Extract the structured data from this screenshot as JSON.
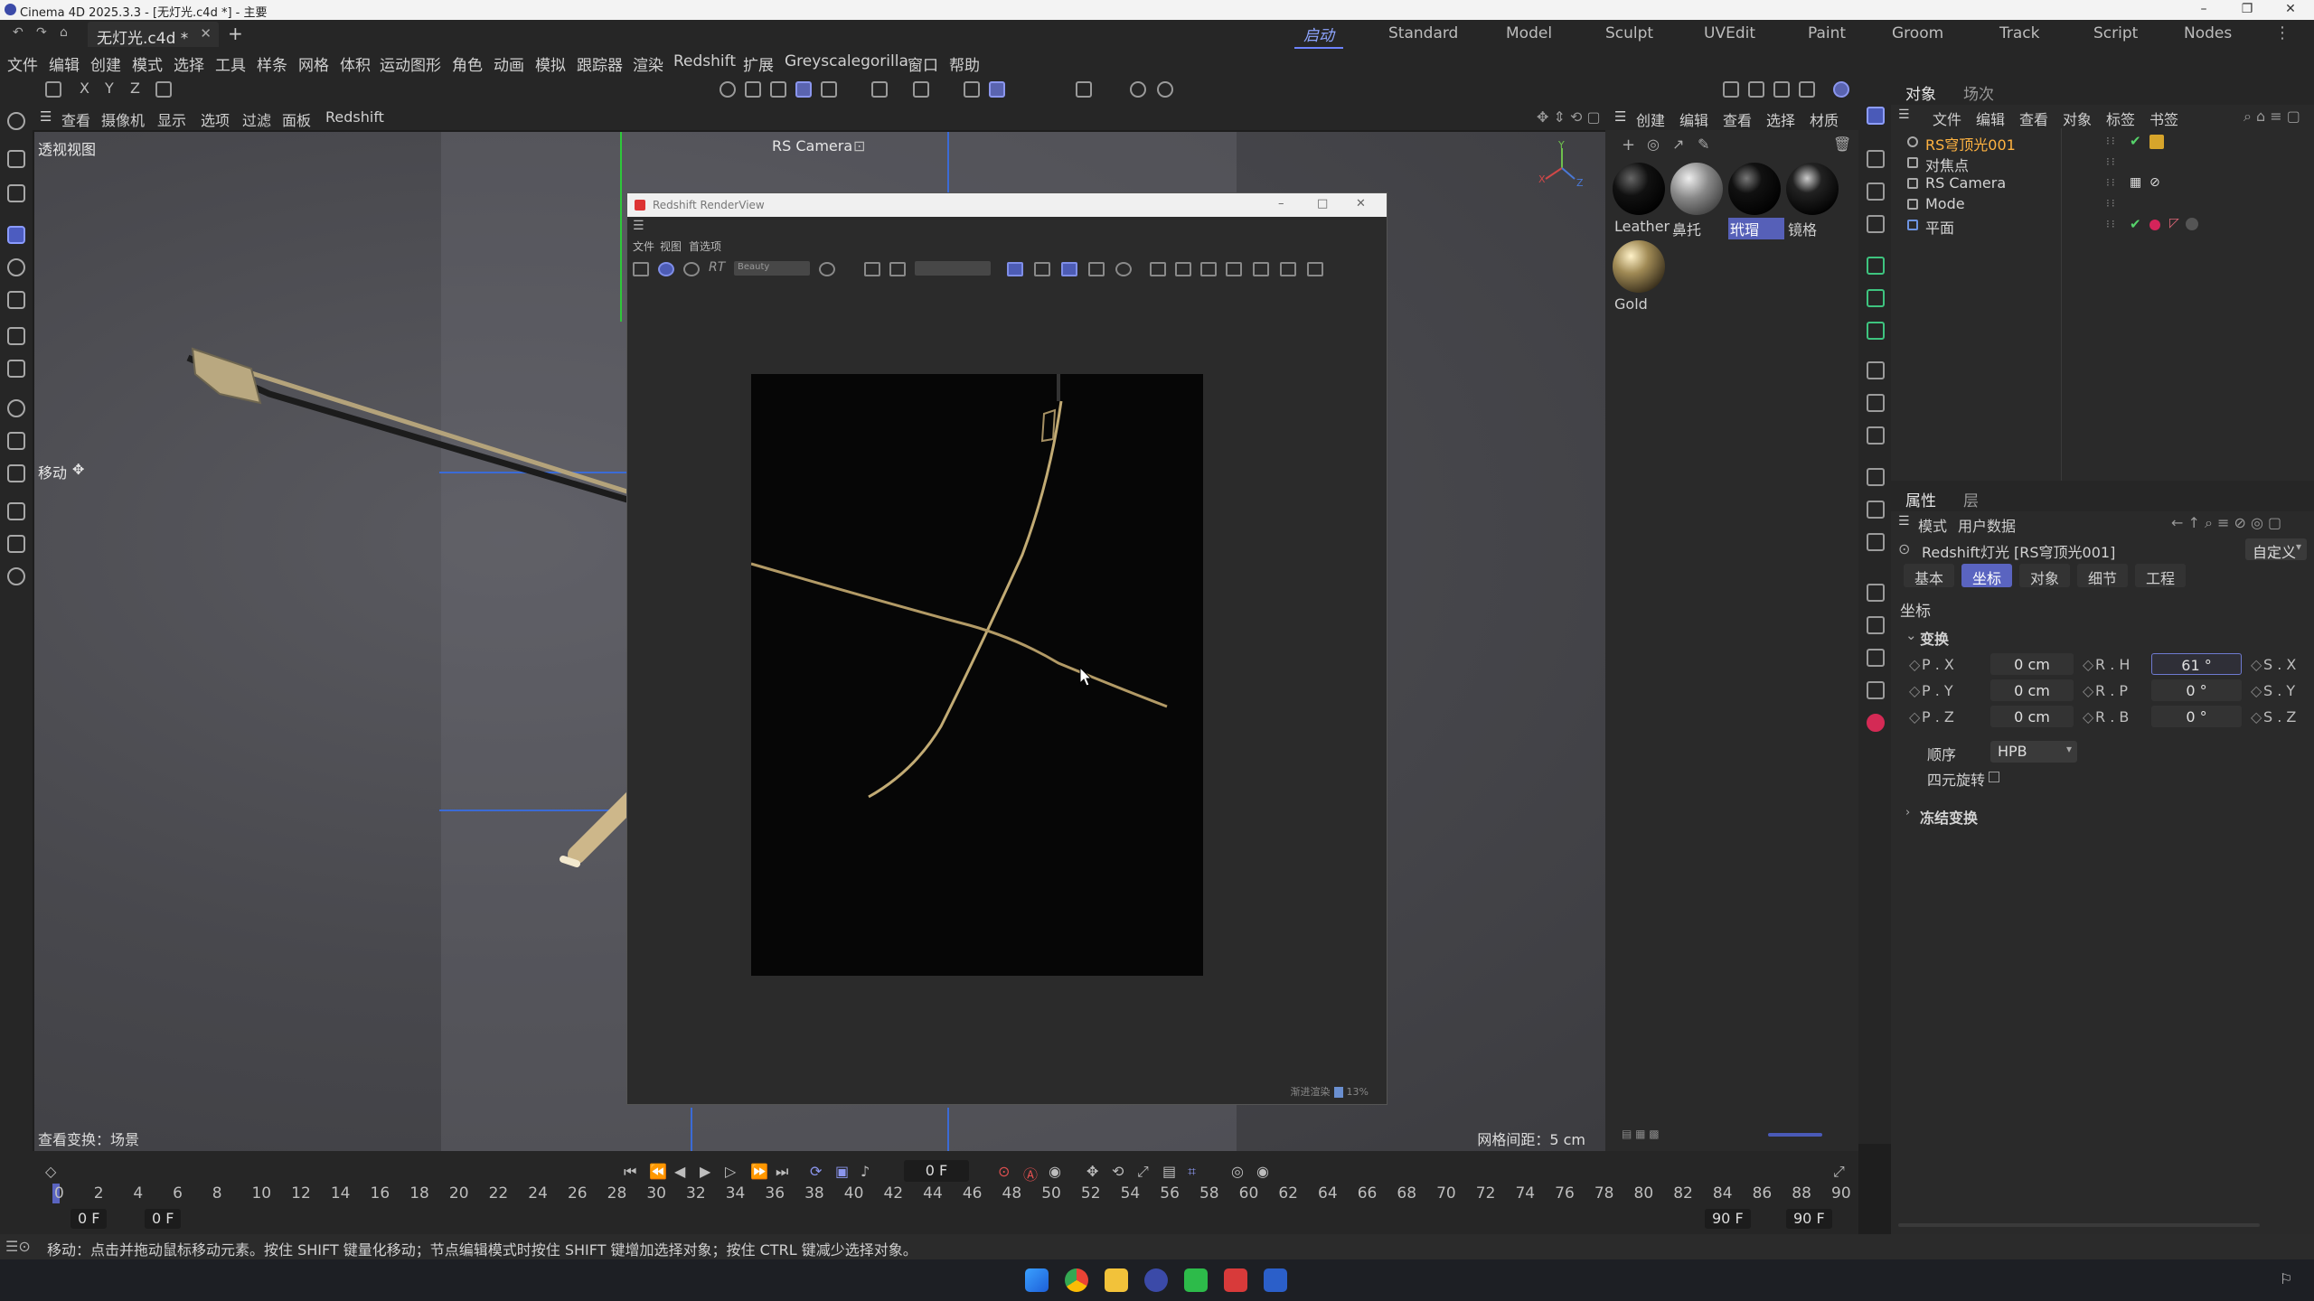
{
  "window": {
    "title": "Cinema 4D 2025.3.3 - [无灯光.c4d *] - 主要",
    "minimize_icon": "minimize-icon",
    "maximize_icon": "restore-icon",
    "close_icon": "close-icon"
  },
  "document": {
    "tab_label": "无灯光.c4d *",
    "add_tab": "+"
  },
  "layouts": {
    "active": "启动",
    "items": [
      "Standard",
      "Model",
      "Sculpt",
      "UVEdit",
      "Paint",
      "Groom",
      "Track",
      "Script",
      "Nodes"
    ]
  },
  "menu": [
    "文件",
    "编辑",
    "创建",
    "模式",
    "选择",
    "工具",
    "样条",
    "网格",
    "体积",
    "运动图形",
    "角色",
    "动画",
    "模拟",
    "跟踪器",
    "渲染",
    "Redshift",
    "扩展",
    "Greyscalegorilla",
    "窗口",
    "帮助"
  ],
  "toolbar": {
    "axes": [
      "X",
      "Y",
      "Z"
    ]
  },
  "viewport": {
    "menu": [
      "查看",
      "摄像机",
      "显示",
      "选项",
      "过滤",
      "面板",
      "Redshift"
    ],
    "label": "透视视图",
    "camera": "RS Camera",
    "move_label": "移动",
    "footer_left": "查看变换：场景",
    "footer_right": "网格间距：5 cm"
  },
  "render_view": {
    "title": "Redshift RenderView",
    "menu": [
      "文件",
      "视图",
      "首选项"
    ],
    "aov_dropdown": "Beauty",
    "status": "渐进渲染",
    "status_percent": "13%"
  },
  "materials": {
    "menu": [
      "创建",
      "编辑",
      "查看",
      "选择",
      "材质"
    ],
    "items": [
      {
        "name": "Leather",
        "color": "#111111"
      },
      {
        "name": "鼻托",
        "color": "#8a8a8a"
      },
      {
        "name": "玳瑁",
        "color": "#0a0a0a"
      },
      {
        "name": "镜格",
        "color": "#1a1a1a"
      },
      {
        "name": "Gold",
        "color": "#a08a55"
      }
    ],
    "selected": "玳瑁"
  },
  "objects": {
    "tabs": [
      "对象",
      "场次"
    ],
    "menu": [
      "文件",
      "编辑",
      "查看",
      "对象",
      "标签",
      "书签"
    ],
    "rows": [
      {
        "name": "RS穹顶光001",
        "selected": true
      },
      {
        "name": "对焦点",
        "selected": false
      },
      {
        "name": "RS Camera",
        "selected": false
      },
      {
        "name": "Mode",
        "selected": false
      },
      {
        "name": "平面",
        "selected": false
      }
    ]
  },
  "attributes": {
    "tabs": [
      "属性",
      "层"
    ],
    "menu": [
      "模式",
      "用户数据"
    ],
    "object_title": "Redshift灯光 [RS穹顶光001]",
    "preset": "自定义",
    "sub_tabs": [
      "基本",
      "坐标",
      "对象",
      "细节",
      "工程"
    ],
    "active_sub_tab": "坐标",
    "section": "坐标",
    "group": "变换",
    "rows": [
      {
        "pos_label": "P . X",
        "pos": "0 cm",
        "rot_label": "R . H",
        "rot": "61 °",
        "scale_label": "S . X"
      },
      {
        "pos_label": "P . Y",
        "pos": "0 cm",
        "rot_label": "R . P",
        "rot": "0 °",
        "scale_label": "S . Y"
      },
      {
        "pos_label": "P . Z",
        "pos": "0 cm",
        "rot_label": "R . B",
        "rot": "0 °",
        "scale_label": "S . Z"
      }
    ],
    "order_label": "顺序",
    "order_value": "HPB",
    "quat_label": "四元旋转",
    "freeze_label": "冻结变换"
  },
  "timeline": {
    "current_frame": "0 F",
    "ticks": [
      "0",
      "2",
      "4",
      "6",
      "8",
      "10",
      "12",
      "14",
      "16",
      "18",
      "20",
      "22",
      "24",
      "26",
      "28",
      "30",
      "32",
      "34",
      "36",
      "38",
      "40",
      "42",
      "44",
      "46",
      "48",
      "50",
      "52",
      "54",
      "56",
      "58",
      "60",
      "62",
      "64",
      "66",
      "68",
      "70",
      "72",
      "74",
      "76",
      "78",
      "80",
      "82",
      "84",
      "86",
      "88",
      "90"
    ],
    "start_a": "0 F",
    "start_b": "0 F",
    "end_a": "90 F",
    "end_b": "90 F"
  },
  "status_bar": "移动：点击并拖动鼠标移动元素。按住 SHIFT 键量化移动；节点编辑模式时按住 SHIFT 键增加选择对象；按住 CTRL 键减少选择对象。",
  "taskbar": {
    "icons": [
      "windows-start-icon",
      "chrome-icon",
      "file-explorer-icon",
      "cinema4d-icon",
      "wechat-icon",
      "app-red-icon",
      "word-icon"
    ]
  }
}
